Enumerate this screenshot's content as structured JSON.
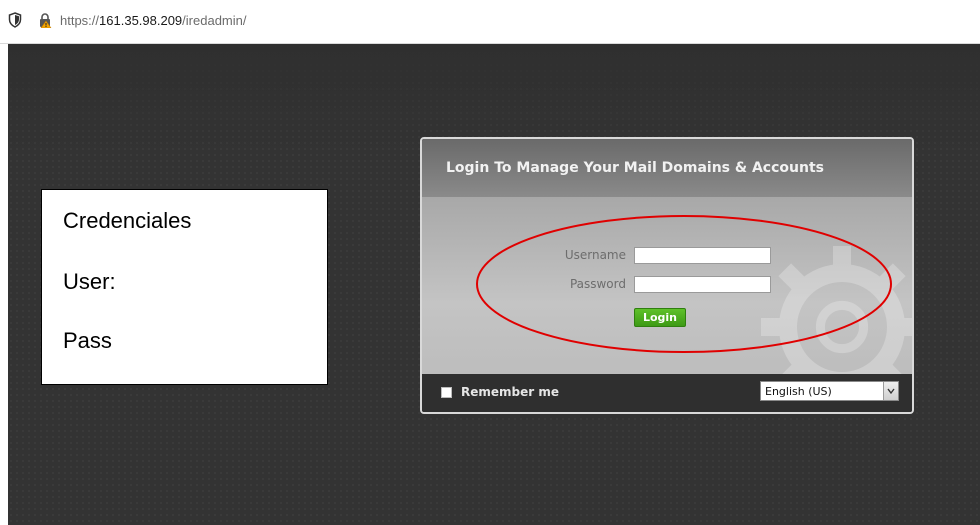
{
  "browser": {
    "url_prefix": "https://",
    "url_host": "161.35.98.209",
    "url_path": "/iredadmin/"
  },
  "annotation": {
    "line1": "Credenciales",
    "line2": "User:",
    "line3": "Pass",
    "highlight_color": "#e00000"
  },
  "login_panel": {
    "title": "Login To Manage Your Mail Domains & Accounts",
    "username_label": "Username",
    "username_value": "",
    "password_label": "Password",
    "password_value": "",
    "login_button": "Login",
    "remember_me": "Remember me",
    "language_selected": "English (US)",
    "accent_color": "#4caf20"
  }
}
